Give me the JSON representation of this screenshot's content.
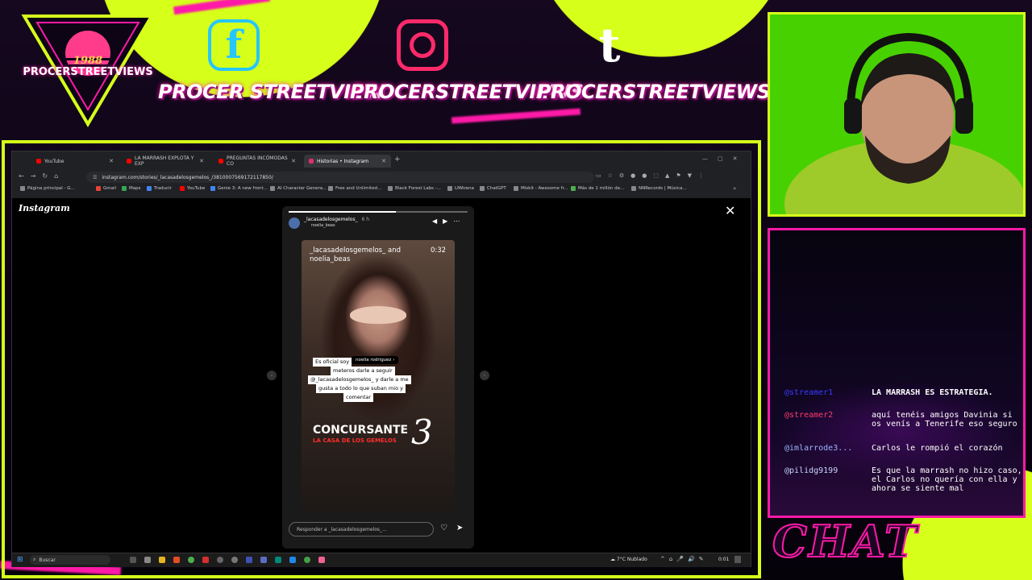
{
  "overlay": {
    "logo": {
      "year": "1988",
      "text": "PROCERSTREETVIEWS"
    },
    "socials": [
      {
        "icon": "facebook-icon",
        "label": "PROCER STREETVIEW",
        "color": "#26c6ff"
      },
      {
        "icon": "instagram-icon",
        "label": "PROCERSTREETVIEWS",
        "color": "#ff2a6a"
      },
      {
        "icon": "tumblr-icon",
        "label": "PROCERSTREETVIEWS",
        "color": "#ffffff"
      }
    ],
    "chat_title": "CHAT",
    "accent_color": "#d6ff1a",
    "pink_color": "#ff1aa8"
  },
  "browser": {
    "tabs": [
      {
        "label": "YouTube",
        "active": false
      },
      {
        "label": "LA MARRASH EXPLOTA Y EXP",
        "active": false
      },
      {
        "label": "PREGUNTAS INCÓMODAS CO",
        "active": false
      },
      {
        "label": "Historias • Instagram",
        "active": true
      }
    ],
    "url": "instagram.com/stories/_lacasadelosgemelos_/3810007569172117850/",
    "bookmarks": [
      "Página principal - G...",
      "Gmail",
      "Maps",
      "Traducir",
      "YouTube",
      "Genie 3: A new front...",
      "AI Character Genera...",
      "Free and Unlimited...",
      "Black Forest Labs -...",
      "LMArena",
      "ChatGPT",
      "Miskit - Awesome fr...",
      "Más de 1 millón de...",
      "NNRecords | Música..."
    ]
  },
  "instagram": {
    "logo": "Instagram",
    "story": {
      "account": "_lacasadelosgemelos_",
      "time": "6 h",
      "sub_account": "noelia_beas",
      "video_title": "_lacasadelosgemelos_ and noelia_beas",
      "duration": "0:32",
      "sticker_line1": "Es oficial soy",
      "mention": "noelia rodriguez",
      "sticker_lines": [
        "meteros darle a seguir",
        "@_lacasadelosgemelos_ y darle a me",
        "gusta a todo lo que suban mio y",
        "comentar"
      ],
      "overlay_title": "CONCURSANTE",
      "overlay_subtitle": "LA CASA DE LOS GEMELOS",
      "overlay_number": "3",
      "reply_placeholder": "Responder a _lacasadelosgemelos_..."
    }
  },
  "taskbar": {
    "search": "Buscar",
    "weather": "7°C  Nublado",
    "time": "0:01"
  },
  "chat": {
    "messages": [
      {
        "user": "@streamer1",
        "text": "LA MARRASH ES ESTRATEGIA."
      },
      {
        "user": "@streamer2",
        "text": "aquí tenéis amigos Davinia si os venís a Tenerife eso seguro"
      },
      {
        "user": "@imlarrode3...",
        "text": "Carlos le rompió el corazón"
      },
      {
        "user": "@pilidg9199",
        "text": "Es que la marrash no hizo caso, el Carlos no quería con ella y ahora se siente mal"
      }
    ]
  }
}
